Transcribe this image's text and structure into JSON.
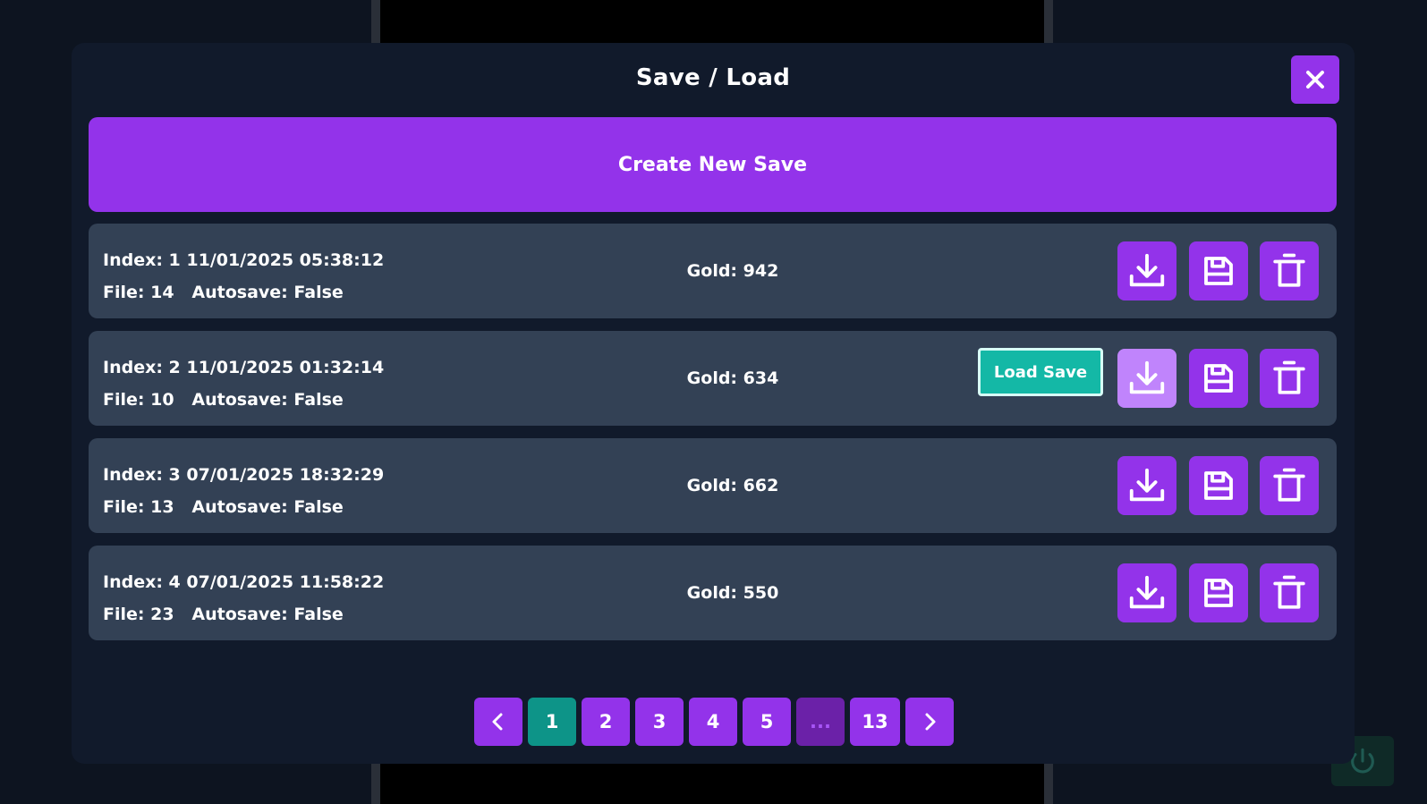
{
  "dialog": {
    "title": "Save / Load",
    "close_icon": "close-icon",
    "create_label": "Create New Save"
  },
  "saves": [
    {
      "index": "Index: 1",
      "datetime": "11/01/2025 05:38:12",
      "file": "File: 14",
      "autosave": "Autosave: False",
      "gold": "Gold: 942"
    },
    {
      "index": "Index: 2",
      "datetime": "11/01/2025 01:32:14",
      "file": "File: 10",
      "autosave": "Autosave: False",
      "gold": "Gold: 634"
    },
    {
      "index": "Index: 3",
      "datetime": "07/01/2025 18:32:29",
      "file": "File: 13",
      "autosave": "Autosave: False",
      "gold": "Gold: 662"
    },
    {
      "index": "Index: 4",
      "datetime": "07/01/2025 11:58:22",
      "file": "File: 23",
      "autosave": "Autosave: False",
      "gold": "Gold: 550"
    }
  ],
  "row_actions": {
    "load_icon": "download-icon",
    "save_icon": "floppy-disk-icon",
    "delete_icon": "trash-icon"
  },
  "tooltip": {
    "label": "Load Save"
  },
  "pagination": {
    "prev_icon": "chevron-left-icon",
    "next_icon": "chevron-right-icon",
    "pages": [
      "1",
      "2",
      "3",
      "4",
      "5",
      "...",
      "13"
    ],
    "current": "1"
  },
  "background": {
    "power_icon": "power-icon"
  },
  "colors": {
    "accent": "#9333ea",
    "accent_hover": "#c084fc",
    "active_page": "#0d9488",
    "tooltip": "#14b8a6",
    "modal_bg": "#111a2b",
    "row_bg": "#334155"
  }
}
